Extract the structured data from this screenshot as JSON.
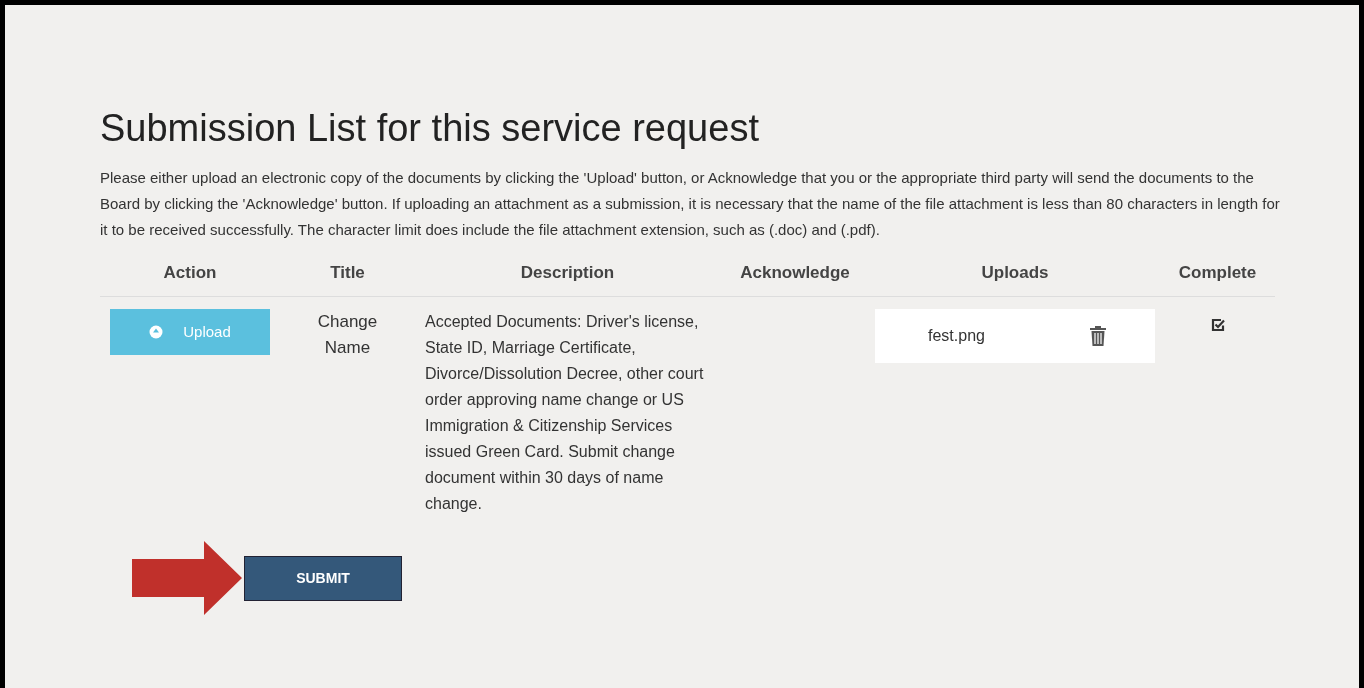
{
  "title": "Submission List for this service request",
  "instructions": "Please either upload an electronic copy of the documents by clicking the 'Upload' button, or Acknowledge that you or the appropriate third party will send the documents to the Board by clicking the 'Acknowledge' button. If uploading an attachment as a submission, it is necessary that the name of the file attachment is less than 80 characters in length for it to be received successfully. The character limit does include the file attachment extension, such as (.doc) and (.pdf).",
  "table": {
    "columns": [
      "Action",
      "Title",
      "Description",
      "Acknowledge",
      "Uploads",
      "Complete"
    ],
    "rows": [
      {
        "action": "Upload",
        "title": "Change Name",
        "description": "Accepted Documents: Driver's license, State ID, Marriage Certificate, Divorce/Dissolution Decree, other court order approving name change or US Immigration & Citizenship Services issued Green Card. Submit change document within 30 days of name change.",
        "uploads": [
          {
            "file": "fest.png"
          }
        ],
        "complete": true
      }
    ]
  },
  "submit_button": "SUBMIT"
}
